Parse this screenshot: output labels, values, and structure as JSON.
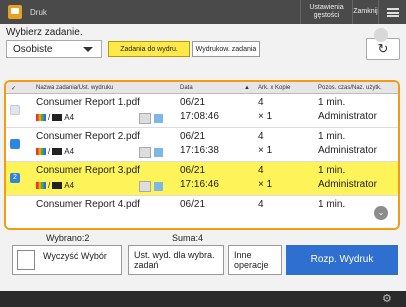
{
  "topbar": {
    "title": "Druk",
    "density_label": "Ustawienia gęstości",
    "close_label": "Zamknij"
  },
  "prompt": "Wybierz zadanie.",
  "filter": {
    "selected": "Osobiste",
    "tab_ready": "Zadania do wydru.",
    "tab_printed": "Wydrukow. zadania"
  },
  "refresh_icon": "↻",
  "list": {
    "headers": {
      "name": "Nazwa zadania/Ust. wydruku",
      "date": "Data",
      "sheets": "Ark. x Kopie",
      "user": "Pozos. czas/Naz. użytk."
    },
    "rows": [
      {
        "name": "Consumer Report 1.pdf",
        "format": "A4",
        "date": "06/21",
        "time": "17:08:46",
        "sheets": "4",
        "copies": "× 1",
        "remaining": "1 min.",
        "user": "Administrator",
        "marker": "",
        "selected": false
      },
      {
        "name": "Consumer Report 2.pdf",
        "format": "A4",
        "date": "06/21",
        "time": "17:16:38",
        "sheets": "4",
        "copies": "× 1",
        "remaining": "1 min.",
        "user": "Administrator",
        "marker": "",
        "selected": false
      },
      {
        "name": "Consumer Report 3.pdf",
        "format": "A4",
        "date": "06/21",
        "time": "17:16:46",
        "sheets": "4",
        "copies": "× 1",
        "remaining": "1 min.",
        "user": "Administrator",
        "marker": "2",
        "selected": true
      },
      {
        "name": "Consumer Report 4.pdf",
        "format": "A4",
        "date": "06/21",
        "time": "",
        "sheets": "4",
        "copies": "",
        "remaining": "1 min.",
        "user": "",
        "marker": "",
        "selected": false
      }
    ]
  },
  "summary": {
    "selected": "Wybrano:2",
    "total": "Suma:4"
  },
  "buttons": {
    "clear_selection": "Wyczyść Wybór",
    "print_settings": "Ust. wyd. dla wybra. zadań",
    "other_ops": "Inne operacje",
    "start_print": "Rozp. Wydruk"
  },
  "status": {
    "left_text": "",
    "right_icon": "⚙"
  }
}
